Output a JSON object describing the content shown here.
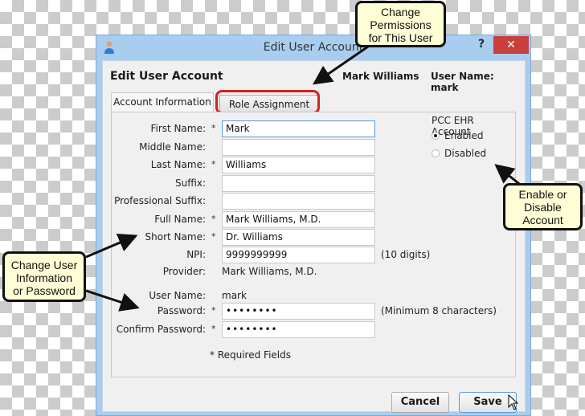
{
  "window": {
    "title": "Edit User Account",
    "icon": "user-icon",
    "help_label": "?",
    "close_label": "✕"
  },
  "header": {
    "title": "Edit User Account",
    "user_full_name": "Mark Williams",
    "user_name_label": "User Name: mark"
  },
  "tabs": [
    {
      "label": "Account Information",
      "active": true
    },
    {
      "label": "Role Assignment",
      "active": false
    }
  ],
  "form": {
    "required_marker": "*",
    "fields": [
      {
        "label": "First Name:",
        "required": true,
        "value": "Mark"
      },
      {
        "label": "Middle Name:",
        "required": false,
        "value": ""
      },
      {
        "label": "Last Name:",
        "required": true,
        "value": "Williams"
      },
      {
        "label": "Suffix:",
        "required": false,
        "value": ""
      },
      {
        "label": "Professional Suffix:",
        "required": false,
        "value": ""
      },
      {
        "label": "Full Name:",
        "required": true,
        "value": "Mark Williams, M.D."
      },
      {
        "label": "Short Name:",
        "required": true,
        "value": "Dr. Williams"
      },
      {
        "label": "NPI:",
        "required": false,
        "value": "9999999999",
        "hint": "(10 digits)"
      }
    ],
    "provider": {
      "label": "Provider:",
      "value": "Mark Williams, M.D."
    },
    "user_name": {
      "label": "User Name:",
      "value": "mark"
    },
    "password": {
      "label": "Password:",
      "required": true,
      "value": "••••••••",
      "hint": "(Minimum 8 characters)"
    },
    "confirm_password": {
      "label": "Confirm Password:",
      "required": true,
      "value": "••••••••"
    },
    "required_note": "* Required Fields"
  },
  "account_status": {
    "title": "PCC EHR Account",
    "options": [
      {
        "label": "Enabled",
        "selected": true
      },
      {
        "label": "Disabled",
        "selected": false
      }
    ]
  },
  "buttons": {
    "cancel": "Cancel",
    "save": "Save"
  },
  "callouts": {
    "permissions": [
      "Change",
      "Permissions",
      "for This User"
    ],
    "enable": [
      "Enable or",
      "Disable",
      "Account"
    ],
    "user_info": [
      "Change User",
      "Information",
      "or Password"
    ]
  },
  "colors": {
    "highlight": "#d42222",
    "callout_bg": "#fefdd6",
    "title_bar": "#a9cdee",
    "close_button": "#c9403a"
  }
}
